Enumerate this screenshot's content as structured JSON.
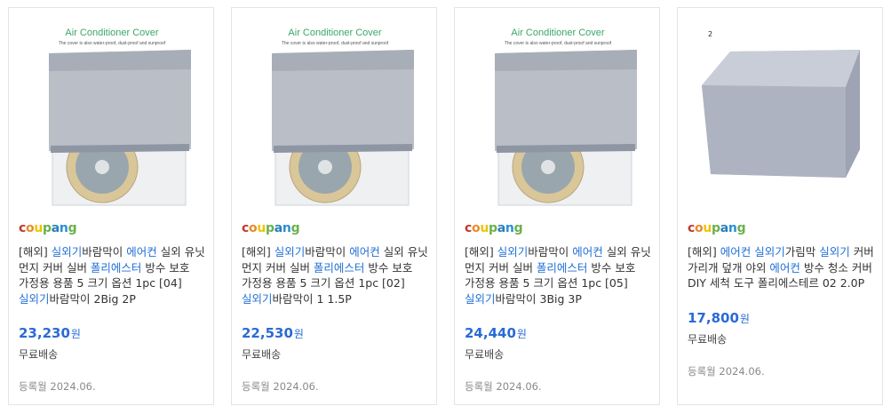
{
  "colors": {
    "accent": "#2a6ad6",
    "keyword": "#1f6fd6",
    "muted": "#8a8a8a"
  },
  "brand": {
    "logo_letters": [
      "c",
      "o",
      "u",
      "p",
      "a",
      "n",
      "g"
    ],
    "logo_colors": [
      "#c0392b",
      "#e58b2a",
      "#f2c200",
      "#6ab04c",
      "#2980b9",
      "#2a8fd6",
      "#6ab04c"
    ]
  },
  "products": [
    {
      "image_caption": "Air Conditioner Cover",
      "image_subcaption": "The cover is also water-proof, dust-proof and sunproof",
      "title_parts": [
        {
          "t": "[해외] ",
          "kw": false
        },
        {
          "t": "실외기",
          "kw": true
        },
        {
          "t": "바람막이 ",
          "kw": false
        },
        {
          "t": "에어컨",
          "kw": true
        },
        {
          "t": " 실외 유닛 먼지 커버 실버 ",
          "kw": false
        },
        {
          "t": "폴리에스터",
          "kw": true
        },
        {
          "t": " 방수 보호 가정용 용품 5 크기 옵션 1pc [04] ",
          "kw": false
        },
        {
          "t": "실외기",
          "kw": true
        },
        {
          "t": "바람막이 2Big 2P",
          "kw": false
        }
      ],
      "price": "23,230",
      "currency": "원",
      "shipping": "무료배송",
      "registered": "등록월 2024.06."
    },
    {
      "image_caption": "Air Conditioner Cover",
      "image_subcaption": "The cover is also water-proof, dust-proof and sunproof",
      "title_parts": [
        {
          "t": "[해외] ",
          "kw": false
        },
        {
          "t": "실외기",
          "kw": true
        },
        {
          "t": "바람막이 ",
          "kw": false
        },
        {
          "t": "에어컨",
          "kw": true
        },
        {
          "t": " 실외 유닛 먼지 커버 실버 ",
          "kw": false
        },
        {
          "t": "폴리에스터",
          "kw": true
        },
        {
          "t": " 방수 보호 가정용 용품 5 크기 옵션 1pc [02] ",
          "kw": false
        },
        {
          "t": "실외기",
          "kw": true
        },
        {
          "t": "바람막이 1 1.5P",
          "kw": false
        }
      ],
      "price": "22,530",
      "currency": "원",
      "shipping": "무료배송",
      "registered": "등록월 2024.06."
    },
    {
      "image_caption": "Air Conditioner Cover",
      "image_subcaption": "The cover is also water-proof, dust-proof and sunproof",
      "title_parts": [
        {
          "t": "[해외] ",
          "kw": false
        },
        {
          "t": "실외기",
          "kw": true
        },
        {
          "t": "바람막이 ",
          "kw": false
        },
        {
          "t": "에어컨",
          "kw": true
        },
        {
          "t": " 실외 유닛 먼지 커버 실버 ",
          "kw": false
        },
        {
          "t": "폴리에스터",
          "kw": true
        },
        {
          "t": " 방수 보호 가정용 용품 5 크기 옵션 1pc [05] ",
          "kw": false
        },
        {
          "t": "실외기",
          "kw": true
        },
        {
          "t": "바람막이 3Big 3P",
          "kw": false
        }
      ],
      "price": "24,440",
      "currency": "원",
      "shipping": "무료배송",
      "registered": "등록월 2024.06."
    },
    {
      "image_badge": "2",
      "title_parts": [
        {
          "t": "[해외] ",
          "kw": false
        },
        {
          "t": "에어컨",
          "kw": true
        },
        {
          "t": " ",
          "kw": false
        },
        {
          "t": "실외기",
          "kw": true
        },
        {
          "t": "가림막 ",
          "kw": false
        },
        {
          "t": "실외기",
          "kw": true
        },
        {
          "t": " 커버 가리개 덮개 야외 ",
          "kw": false
        },
        {
          "t": "에어컨",
          "kw": true
        },
        {
          "t": " 방수 청소 커버 DIY 세척 도구 폴리에스테르 02 2.0P",
          "kw": false
        }
      ],
      "price": "17,800",
      "currency": "원",
      "shipping": "무료배송",
      "registered": "등록월 2024.06."
    }
  ]
}
